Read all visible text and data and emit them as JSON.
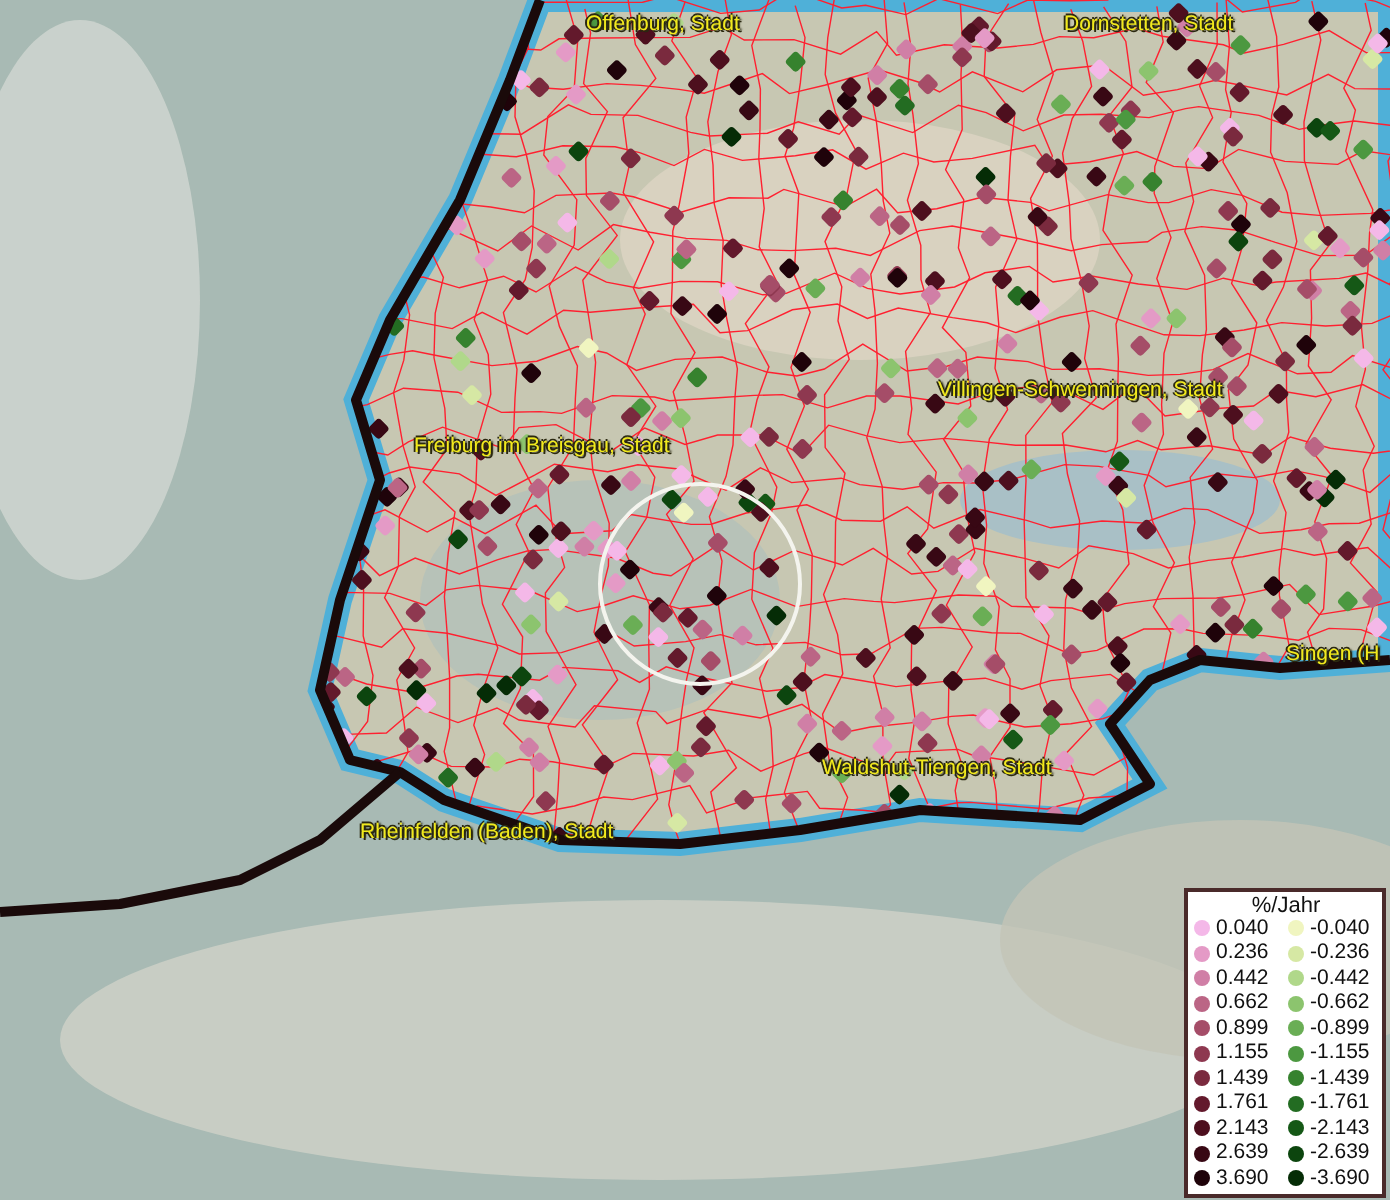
{
  "map": {
    "places": [
      {
        "name": "Offenburg, Stadt"
      },
      {
        "name": "Dornstetten, Stadt"
      },
      {
        "name": "Villingen-Schwenningen, Stadt"
      },
      {
        "name": "Freiburg im Breisgau, Stadt"
      },
      {
        "name": "Singen (H"
      },
      {
        "name": "Waldshut-Tiengen, Stadt"
      },
      {
        "name": "Rheinfelden (Baden), Stadt"
      }
    ]
  },
  "legend": {
    "title": "%/Jahr",
    "entries": [
      {
        "label": "0.040",
        "color": "#f4b8e8"
      },
      {
        "label": "-0.040",
        "color": "#f0f5c0"
      },
      {
        "label": "0.236",
        "color": "#e49ac6"
      },
      {
        "label": "-0.236",
        "color": "#d6e8a4"
      },
      {
        "label": "0.442",
        "color": "#d07fa6"
      },
      {
        "label": "-0.442",
        "color": "#b0d88a"
      },
      {
        "label": "0.662",
        "color": "#bb6585"
      },
      {
        "label": "-0.662",
        "color": "#8cc46e"
      },
      {
        "label": "0.899",
        "color": "#a54d68"
      },
      {
        "label": "-0.899",
        "color": "#6aae55"
      },
      {
        "label": "1.155",
        "color": "#8e3850"
      },
      {
        "label": "-1.155",
        "color": "#4c9840"
      },
      {
        "label": "1.439",
        "color": "#7a2a3e"
      },
      {
        "label": "-1.439",
        "color": "#36822e"
      },
      {
        "label": "1.761",
        "color": "#63192c"
      },
      {
        "label": "-1.761",
        "color": "#236c22"
      },
      {
        "label": "2.143",
        "color": "#4d0f1e"
      },
      {
        "label": "-2.143",
        "color": "#155816"
      },
      {
        "label": "2.639",
        "color": "#380814"
      },
      {
        "label": "-2.639",
        "color": "#0c450e"
      },
      {
        "label": "3.690",
        "color": "#1f030a"
      },
      {
        "label": "-3.690",
        "color": "#052c06"
      }
    ]
  }
}
